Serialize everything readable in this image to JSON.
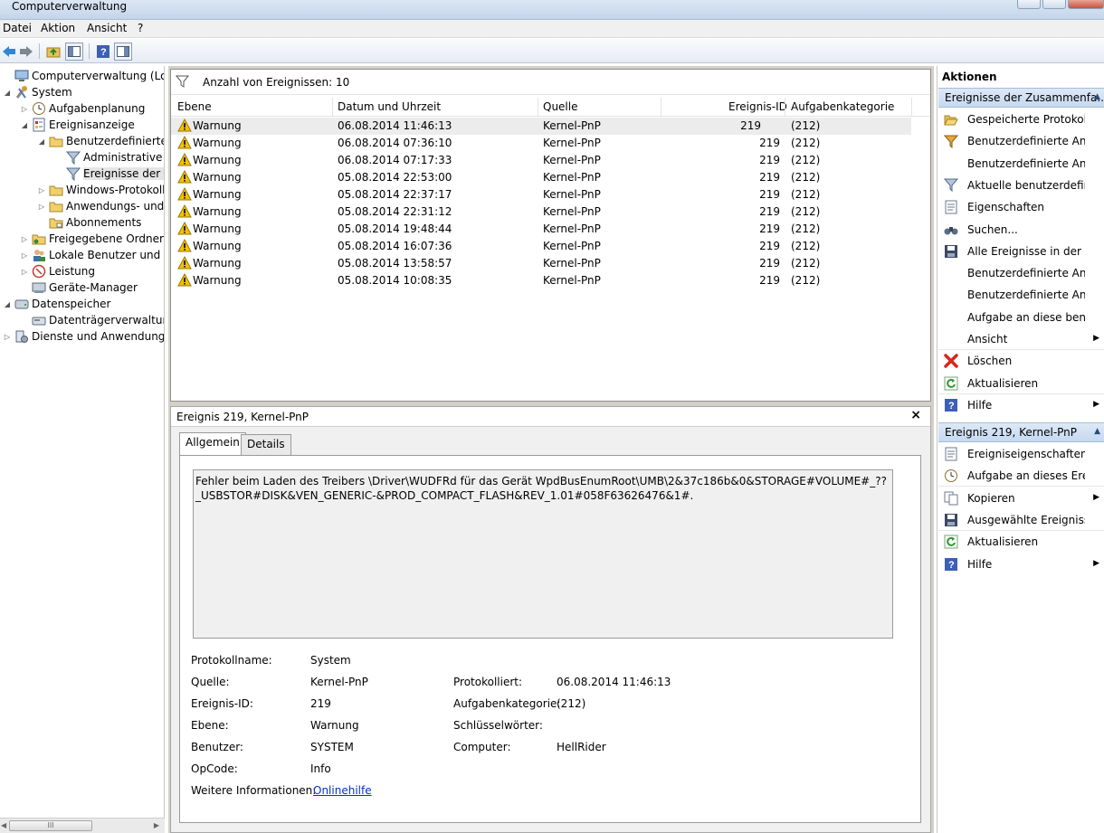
{
  "window": {
    "title": "Computerverwaltung"
  },
  "menu": [
    "Datei",
    "Aktion",
    "Ansicht",
    "?"
  ],
  "tree": [
    {
      "label": "Computerverwaltung (Lokal)",
      "level": 0,
      "exp": "",
      "icon": "computer-icon"
    },
    {
      "label": "System",
      "level": 0,
      "exp": "◢",
      "icon": "tools-icon"
    },
    {
      "label": "Aufgabenplanung",
      "level": 1,
      "exp": "▷",
      "icon": "clock-icon"
    },
    {
      "label": "Ereignisanzeige",
      "level": 1,
      "exp": "◢",
      "icon": "event-viewer-icon"
    },
    {
      "label": "Benutzerdefinierte A",
      "level": 2,
      "exp": "◢",
      "icon": "folder-icon"
    },
    {
      "label": "Administrative E",
      "level": 3,
      "exp": "",
      "icon": "filter-icon"
    },
    {
      "label": "Ereignisse der Zu",
      "level": 3,
      "exp": "",
      "icon": "filter-icon",
      "selected": true
    },
    {
      "label": "Windows-Protokolle",
      "level": 2,
      "exp": "▷",
      "icon": "folder-icon"
    },
    {
      "label": "Anwendungs- und D",
      "level": 2,
      "exp": "▷",
      "icon": "folder-icon"
    },
    {
      "label": "Abonnements",
      "level": 2,
      "exp": "",
      "icon": "subscription-icon"
    },
    {
      "label": "Freigegebene Ordner",
      "level": 1,
      "exp": "▷",
      "icon": "shared-folder-icon"
    },
    {
      "label": "Lokale Benutzer und Gru",
      "level": 1,
      "exp": "▷",
      "icon": "users-icon"
    },
    {
      "label": "Leistung",
      "level": 1,
      "exp": "▷",
      "icon": "performance-icon"
    },
    {
      "label": "Geräte-Manager",
      "level": 1,
      "exp": "",
      "icon": "device-manager-icon"
    },
    {
      "label": "Datenspeicher",
      "level": 0,
      "exp": "◢",
      "icon": "storage-icon"
    },
    {
      "label": "Datenträgerverwaltung",
      "level": 1,
      "exp": "",
      "icon": "disk-icon"
    },
    {
      "label": "Dienste und Anwendungen",
      "level": 0,
      "exp": "▷",
      "icon": "services-icon"
    }
  ],
  "tree_scroll_grip": "III",
  "events": {
    "count_label": "Anzahl von Ereignissen: 10",
    "columns": [
      "Ebene",
      "Datum und Uhrzeit",
      "Quelle",
      "Ereignis-ID",
      "Aufgabenkategorie"
    ],
    "rows": [
      {
        "level": "Warnung",
        "date": "06.08.2014 11:46:13",
        "source": "Kernel-PnP",
        "id": "219",
        "category": "(212)"
      },
      {
        "level": "Warnung",
        "date": "06.08.2014 07:36:10",
        "source": "Kernel-PnP",
        "id": "219",
        "category": "(212)"
      },
      {
        "level": "Warnung",
        "date": "06.08.2014 07:17:33",
        "source": "Kernel-PnP",
        "id": "219",
        "category": "(212)"
      },
      {
        "level": "Warnung",
        "date": "05.08.2014 22:53:00",
        "source": "Kernel-PnP",
        "id": "219",
        "category": "(212)"
      },
      {
        "level": "Warnung",
        "date": "05.08.2014 22:37:17",
        "source": "Kernel-PnP",
        "id": "219",
        "category": "(212)"
      },
      {
        "level": "Warnung",
        "date": "05.08.2014 22:31:12",
        "source": "Kernel-PnP",
        "id": "219",
        "category": "(212)"
      },
      {
        "level": "Warnung",
        "date": "05.08.2014 19:48:44",
        "source": "Kernel-PnP",
        "id": "219",
        "category": "(212)"
      },
      {
        "level": "Warnung",
        "date": "05.08.2014 16:07:36",
        "source": "Kernel-PnP",
        "id": "219",
        "category": "(212)"
      },
      {
        "level": "Warnung",
        "date": "05.08.2014 13:58:57",
        "source": "Kernel-PnP",
        "id": "219",
        "category": "(212)"
      },
      {
        "level": "Warnung",
        "date": "05.08.2014 10:08:35",
        "source": "Kernel-PnP",
        "id": "219",
        "category": "(212)"
      }
    ]
  },
  "detail": {
    "title": "Ereignis 219, Kernel-PnP",
    "close": "×",
    "tabs": [
      "Allgemein",
      "Details"
    ],
    "message": "Fehler beim Laden des Treibers \\Driver\\WUDFRd für das Gerät WpdBusEnumRoot\\UMB\\2&37c186b&0&STORAGE#VOLUME#_??_USBSTOR#DISK&VEN_GENERIC-&PROD_COMPACT_FLASH&REV_1.01#058F63626476&1#.",
    "labels": {
      "log_name": "Protokollname:",
      "source": "Quelle:",
      "event_id": "Ereignis-ID:",
      "level": "Ebene:",
      "user": "Benutzer:",
      "opcode": "OpCode:",
      "more_info": "Weitere Informationen:",
      "logged": "Protokolliert:",
      "task_category": "Aufgabenkategorie:",
      "keywords": "Schlüsselwörter:",
      "computer": "Computer:"
    },
    "values": {
      "log_name": "System",
      "source": "Kernel-PnP",
      "event_id": "219",
      "level": "Warnung",
      "user": "SYSTEM",
      "opcode": "Info",
      "more_info": "Onlinehilfe",
      "logged": "06.08.2014 11:46:13",
      "task_category": "(212)",
      "keywords": "",
      "computer": "HellRider"
    }
  },
  "actions": {
    "title": "Aktionen",
    "section1": "Ereignisse der Zusammenfa...",
    "items1": [
      {
        "label": "Gespeicherte Protokoll...",
        "icon": "open-folder-icon"
      },
      {
        "label": "Benutzerdefinierte Ansi...",
        "icon": "filter-create-icon"
      },
      {
        "label": "Benutzerdefinierte Ansi...",
        "icon": ""
      },
      {
        "label": "Aktuelle benutzerdefini...",
        "icon": "filter-icon"
      },
      {
        "label": "Eigenschaften",
        "icon": "properties-icon"
      },
      {
        "label": "Suchen...",
        "icon": "binoculars-icon"
      },
      {
        "label": "Alle Ereignisse in der b...",
        "icon": "save-icon"
      },
      {
        "label": "Benutzerdefinierte Ansi...",
        "icon": ""
      },
      {
        "label": "Benutzerdefinierte Ansi...",
        "icon": ""
      },
      {
        "label": "Aufgabe an diese benu...",
        "icon": ""
      },
      {
        "label": "Ansicht",
        "icon": "",
        "submenu": true
      },
      {
        "label": "Löschen",
        "icon": "delete-icon"
      },
      {
        "label": "Aktualisieren",
        "icon": "refresh-icon"
      },
      {
        "label": "Hilfe",
        "icon": "help-icon",
        "submenu": true
      }
    ],
    "section2": "Ereignis 219, Kernel-PnP",
    "items2": [
      {
        "label": "Ereigniseigenschaften",
        "icon": "properties-icon"
      },
      {
        "label": "Aufgabe an dieses Erei...",
        "icon": "task-icon"
      },
      {
        "label": "Kopieren",
        "icon": "copy-icon",
        "submenu": true
      },
      {
        "label": "Ausgewählte Ereignisse...",
        "icon": "save-icon"
      },
      {
        "label": "Aktualisieren",
        "icon": "refresh-icon"
      },
      {
        "label": "Hilfe",
        "icon": "help-icon",
        "submenu": true
      }
    ]
  },
  "colors": {
    "accent": "#c6d9f0",
    "selection": "#e5e5e5",
    "warning": "#f2c200",
    "link": "#0033cc",
    "delete": "#d9261c"
  }
}
